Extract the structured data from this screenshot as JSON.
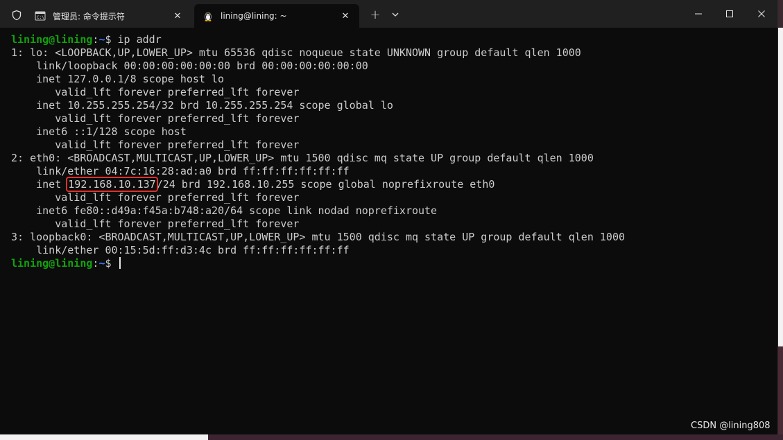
{
  "titlebar": {
    "tabs": [
      {
        "label": "管理员: 命令提示符",
        "icon": "cmd-icon",
        "close": "✕"
      },
      {
        "label": "lining@lining: ~",
        "icon": "linux-tux-icon",
        "close": "✕"
      }
    ],
    "new_tab": "+",
    "controls": {
      "minimize": "minimize-icon",
      "maximize": "maximize-icon",
      "close": "close-icon"
    }
  },
  "terminal": {
    "prompt_user": "lining@lining",
    "prompt_sep": ":",
    "prompt_path": "~",
    "prompt_sym": "$",
    "command": " ip addr",
    "lines": [
      "1: lo: <LOOPBACK,UP,LOWER_UP> mtu 65536 qdisc noqueue state UNKNOWN group default qlen 1000",
      "    link/loopback 00:00:00:00:00:00 brd 00:00:00:00:00:00",
      "    inet 127.0.0.1/8 scope host lo",
      "       valid_lft forever preferred_lft forever",
      "    inet 10.255.255.254/32 brd 10.255.255.254 scope global lo",
      "       valid_lft forever preferred_lft forever",
      "    inet6 ::1/128 scope host",
      "       valid_lft forever preferred_lft forever",
      "2: eth0: <BROADCAST,MULTICAST,UP,LOWER_UP> mtu 1500 qdisc mq state UP group default qlen 1000",
      "    link/ether 04:7c:16:28:ad:a0 brd ff:ff:ff:ff:ff:ff"
    ],
    "highlight_line": {
      "prefix": "    inet ",
      "highlight": "192.168.10.137",
      "suffix": "/24 brd 192.168.10.255 scope global noprefixroute eth0"
    },
    "lines_after": [
      "       valid_lft forever preferred_lft forever",
      "    inet6 fe80::d49a:f45a:b748:a20/64 scope link nodad noprefixroute",
      "       valid_lft forever preferred_lft forever",
      "3: loopback0: <BROADCAST,MULTICAST,UP,LOWER_UP> mtu 1500 qdisc mq state UP group default qlen 1000",
      "    link/ether 00:15:5d:ff:d3:4c brd ff:ff:ff:ff:ff:ff"
    ]
  },
  "watermark": "CSDN @lining808",
  "colors": {
    "terminal_bg": "#0c0c0c",
    "prompt_user": "#13a10e",
    "prompt_path": "#3b78ff",
    "highlight_box": "#e0312c"
  }
}
